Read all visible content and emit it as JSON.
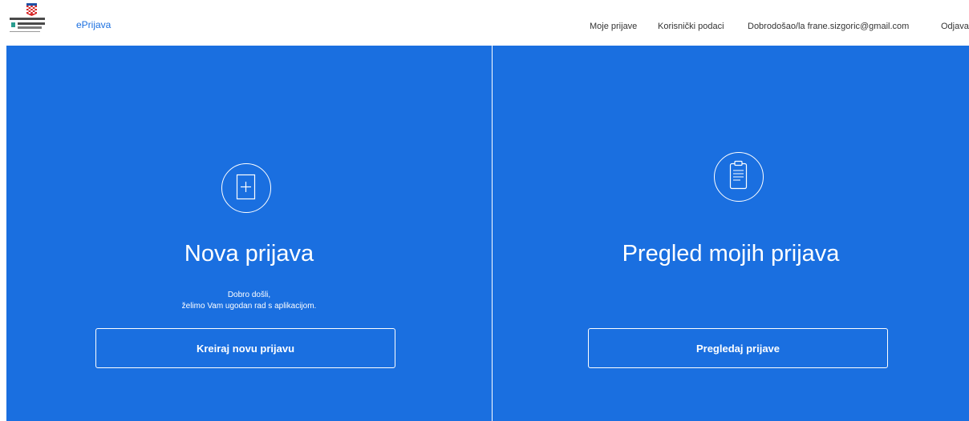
{
  "header": {
    "app_name": "ePrijava",
    "logo_lines": [
      "REPUBLIKA HRVATSKA",
      "SPLITSKO-DALMATINSKA",
      "ŽUPANIJA"
    ],
    "nav": {
      "my_applications": "Moje prijave",
      "user_data": "Korisnički podaci",
      "welcome_user": "Dobrodošao/la frane.sizgoric@gmail.com",
      "logout": "Odjava"
    }
  },
  "left_panel": {
    "icon": "document-plus-icon",
    "title": "Nova prijava",
    "welcome_line1": "Dobro došli,",
    "welcome_line2": "želimo Vam ugodan rad s aplikacijom.",
    "button_label": "Kreiraj novu prijavu"
  },
  "right_panel": {
    "icon": "clipboard-icon",
    "title": "Pregled mojih prijava",
    "button_label": "Pregledaj prijave"
  },
  "colors": {
    "primary": "#1a6fe0",
    "text_dark": "#333333",
    "white": "#ffffff"
  }
}
